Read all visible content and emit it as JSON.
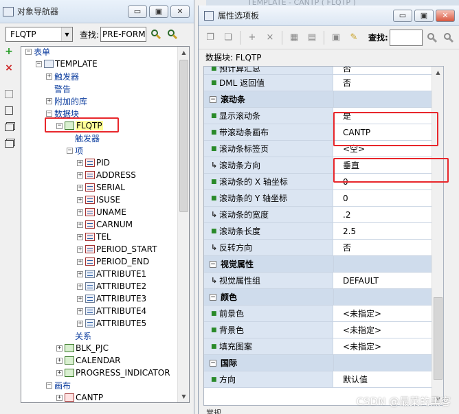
{
  "navigator": {
    "title": "对象导航器",
    "window_buttons": [
      "▭",
      "▣",
      "✕"
    ],
    "combo_value": "FLQTP",
    "find_label": "查找:",
    "find_value": "PRE-FORM",
    "side_add": "+",
    "side_delete": "×",
    "tree": [
      {
        "label": "表单",
        "level": 0,
        "toggle": "−",
        "icon": "none",
        "style": "blue"
      },
      {
        "label": "TEMPLATE",
        "level": 1,
        "toggle": "−",
        "icon": "form",
        "style": "normal"
      },
      {
        "label": "触发器",
        "level": 2,
        "toggle": "+",
        "icon": "none",
        "style": "blue"
      },
      {
        "label": "警告",
        "level": 2,
        "toggle": "",
        "icon": "none",
        "style": "blue"
      },
      {
        "label": "附加的库",
        "level": 2,
        "toggle": "+",
        "icon": "none",
        "style": "blue"
      },
      {
        "label": "数据块",
        "level": 2,
        "toggle": "−",
        "icon": "none",
        "style": "blue"
      },
      {
        "label": "FLQTP",
        "level": 3,
        "toggle": "−",
        "icon": "block",
        "style": "highlight"
      },
      {
        "label": "触发器",
        "level": 4,
        "toggle": "",
        "icon": "none",
        "style": "blue"
      },
      {
        "label": "项",
        "level": 4,
        "toggle": "−",
        "icon": "none",
        "style": "blue"
      },
      {
        "label": "PID",
        "level": 5,
        "toggle": "+",
        "icon": "item-red",
        "style": "normal"
      },
      {
        "label": "ADDRESS",
        "level": 5,
        "toggle": "+",
        "icon": "item-red",
        "style": "normal"
      },
      {
        "label": "SERIAL",
        "level": 5,
        "toggle": "+",
        "icon": "item-red",
        "style": "normal"
      },
      {
        "label": "ISUSE",
        "level": 5,
        "toggle": "+",
        "icon": "item-red",
        "style": "normal"
      },
      {
        "label": "UNAME",
        "level": 5,
        "toggle": "+",
        "icon": "item-red",
        "style": "normal"
      },
      {
        "label": "CARNUM",
        "level": 5,
        "toggle": "+",
        "icon": "item-red",
        "style": "normal"
      },
      {
        "label": "TEL",
        "level": 5,
        "toggle": "+",
        "icon": "item-red",
        "style": "normal"
      },
      {
        "label": "PERIOD_START",
        "level": 5,
        "toggle": "+",
        "icon": "item-red",
        "style": "normal"
      },
      {
        "label": "PERIOD_END",
        "level": 5,
        "toggle": "+",
        "icon": "item-red",
        "style": "normal"
      },
      {
        "label": "ATTRIBUTE1",
        "level": 5,
        "toggle": "+",
        "icon": "item",
        "style": "normal"
      },
      {
        "label": "ATTRIBUTE2",
        "level": 5,
        "toggle": "+",
        "icon": "item",
        "style": "normal"
      },
      {
        "label": "ATTRIBUTE3",
        "level": 5,
        "toggle": "+",
        "icon": "item",
        "style": "normal"
      },
      {
        "label": "ATTRIBUTE4",
        "level": 5,
        "toggle": "+",
        "icon": "item",
        "style": "normal"
      },
      {
        "label": "ATTRIBUTE5",
        "level": 5,
        "toggle": "+",
        "icon": "item",
        "style": "normal"
      },
      {
        "label": "关系",
        "level": 4,
        "toggle": "",
        "icon": "none",
        "style": "blue"
      },
      {
        "label": "BLK_PJC",
        "level": 3,
        "toggle": "+",
        "icon": "block",
        "style": "normal"
      },
      {
        "label": "CALENDAR",
        "level": 3,
        "toggle": "+",
        "icon": "block",
        "style": "normal"
      },
      {
        "label": "PROGRESS_INDICATOR",
        "level": 3,
        "toggle": "+",
        "icon": "block",
        "style": "normal"
      },
      {
        "label": "画布",
        "level": 2,
        "toggle": "−",
        "icon": "none",
        "style": "blue"
      },
      {
        "label": "CANTP",
        "level": 3,
        "toggle": "+",
        "icon": "canvas",
        "style": "normal"
      }
    ]
  },
  "palette": {
    "background_title": "TEMPLATE - CANTP ( FLQTP )",
    "title": "属性选项板",
    "window_buttons": [
      "▭",
      "▣",
      "✕"
    ],
    "find_label": "查找:",
    "context": "数据块: FLQTP",
    "rows": [
      {
        "kind": "prop",
        "name": "预计算汇总",
        "value": "否",
        "marker": "dot",
        "short": true
      },
      {
        "kind": "prop",
        "name": "DML 返回值",
        "value": "否",
        "marker": "dot"
      },
      {
        "kind": "cat",
        "name": "滚动条"
      },
      {
        "kind": "prop",
        "name": "显示滚动条",
        "value": "是",
        "marker": "dot"
      },
      {
        "kind": "prop",
        "name": "带滚动条画布",
        "value": "CANTP",
        "marker": "dot"
      },
      {
        "kind": "prop",
        "name": "滚动条标签页",
        "value": "<空>",
        "marker": "dot"
      },
      {
        "kind": "prop",
        "name": "滚动条方向",
        "value": "垂直",
        "marker": "arrow"
      },
      {
        "kind": "prop",
        "name": "滚动条的 X 轴坐标",
        "value": "0",
        "marker": "dot"
      },
      {
        "kind": "prop",
        "name": "滚动条的 Y 轴坐标",
        "value": "0",
        "marker": "dot"
      },
      {
        "kind": "prop",
        "name": "滚动条的宽度",
        "value": ".2",
        "marker": "arrow"
      },
      {
        "kind": "prop",
        "name": "滚动条长度",
        "value": "2.5",
        "marker": "dot"
      },
      {
        "kind": "prop",
        "name": "反转方向",
        "value": "否",
        "marker": "arrow"
      },
      {
        "kind": "cat",
        "name": "视觉属性"
      },
      {
        "kind": "prop",
        "name": "视觉属性组",
        "value": "DEFAULT",
        "marker": "arrow"
      },
      {
        "kind": "cat",
        "name": "颜色"
      },
      {
        "kind": "prop",
        "name": "前景色",
        "value": "<未指定>",
        "marker": "dot"
      },
      {
        "kind": "prop",
        "name": "背景色",
        "value": "<未指定>",
        "marker": "dot"
      },
      {
        "kind": "prop",
        "name": "填充图案",
        "value": "<未指定>",
        "marker": "dot"
      },
      {
        "kind": "cat",
        "name": "国际"
      },
      {
        "kind": "prop",
        "name": "方向",
        "value": "默认值",
        "marker": "dot"
      }
    ],
    "footer_peek": "常规"
  },
  "watermark": "CSDN @最菜的黑客"
}
